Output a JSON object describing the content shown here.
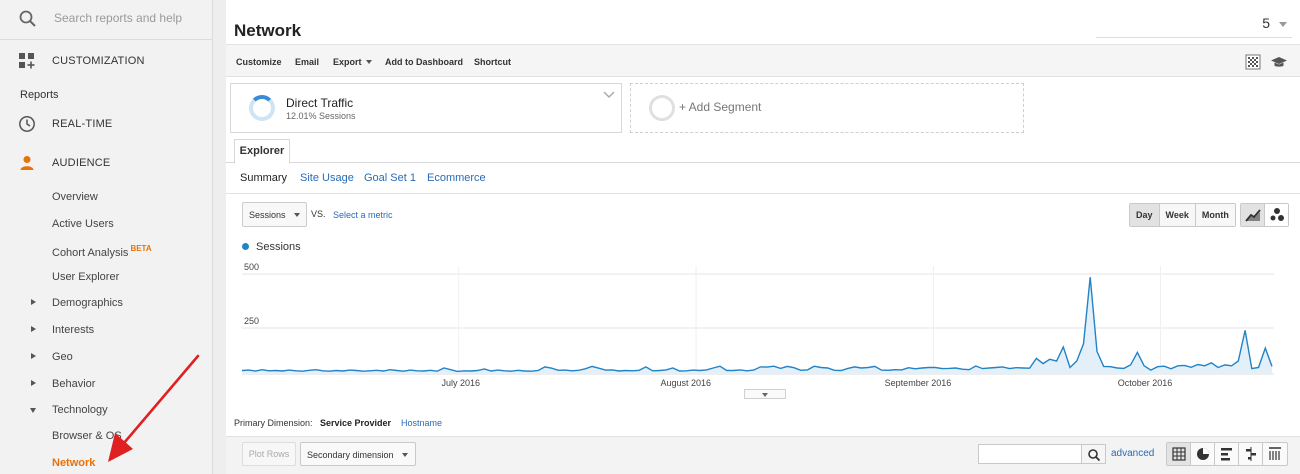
{
  "search": {
    "placeholder": "Search reports and help"
  },
  "nav": {
    "customization": "CUSTOMIZATION",
    "reports_heading": "Reports",
    "realtime": "REAL-TIME",
    "audience": "AUDIENCE",
    "audience_items": [
      {
        "label": "Overview"
      },
      {
        "label": "Active Users"
      },
      {
        "label": "Cohort Analysis",
        "badge": "BETA"
      },
      {
        "label": "User Explorer"
      },
      {
        "label": "Demographics"
      },
      {
        "label": "Interests"
      },
      {
        "label": "Geo"
      },
      {
        "label": "Behavior"
      },
      {
        "label": "Technology"
      },
      {
        "label": "Browser & OS"
      },
      {
        "label": "Network"
      }
    ]
  },
  "page": {
    "title": "Network",
    "date_fragment": "5"
  },
  "toolbar": {
    "customize": "Customize",
    "email": "Email",
    "export": "Export",
    "add_to_dashboard": "Add to Dashboard",
    "shortcut": "Shortcut"
  },
  "segments": {
    "active": {
      "name": "Direct Traffic",
      "sub": "12.01% Sessions"
    },
    "add": "+ Add Segment"
  },
  "tabs": {
    "explorer": "Explorer",
    "subtabs": [
      "Summary",
      "Site Usage",
      "Goal Set 1",
      "Ecommerce"
    ]
  },
  "metric": {
    "selected": "Sessions",
    "vs": "VS.",
    "select_metric": "Select a metric"
  },
  "periods": [
    "Day",
    "Week",
    "Month"
  ],
  "chart_data": {
    "type": "line",
    "series": [
      {
        "name": "Sessions",
        "values": [
          16,
          18,
          14,
          20,
          15,
          16,
          14,
          18,
          15,
          13,
          17,
          20,
          15,
          13,
          16,
          14,
          18,
          16,
          13,
          15,
          17,
          14,
          20,
          16,
          13,
          18,
          15,
          14,
          17,
          13,
          28,
          20,
          12,
          15,
          14,
          16,
          23,
          14,
          18,
          15,
          13,
          17,
          14,
          13,
          16,
          33,
          27,
          17,
          18,
          15,
          17,
          24,
          35,
          27,
          18,
          19,
          14,
          16,
          15,
          17,
          33,
          15,
          16,
          19,
          28,
          14,
          15,
          18,
          16,
          19,
          28,
          36,
          16,
          16,
          19,
          15,
          18,
          33,
          32,
          36,
          26,
          35,
          29,
          17,
          19,
          36,
          30,
          28,
          17,
          16,
          26,
          33,
          28,
          30,
          35,
          18,
          17,
          20,
          19,
          29,
          24,
          28,
          30,
          30,
          25,
          26,
          28,
          22,
          20,
          37,
          25,
          28,
          30,
          33,
          25,
          29,
          28,
          27,
          72,
          48,
          68,
          60,
          125,
          30,
          60,
          140,
          448,
          104,
          35,
          34,
          28,
          26,
          42,
          100,
          38,
          18,
          34,
          36,
          24,
          38,
          40,
          31,
          44,
          38,
          52,
          30,
          42,
          38,
          60,
          202,
          25,
          30,
          120,
          35
        ]
      }
    ],
    "x_tick_labels": [
      "July 2016",
      "August 2016",
      "September 2016",
      "October 2016"
    ],
    "y_tick_labels": [
      "500",
      "250"
    ],
    "ylim": [
      0,
      500
    ],
    "color": "#2283c6",
    "area_fill": "#e3f0fa",
    "grid": true
  },
  "primary_dimension": {
    "label": "Primary Dimension:",
    "selected": "Service Provider",
    "other": "Hostname"
  },
  "table_controls": {
    "plot_rows": "Plot Rows",
    "secondary_dimension": "Secondary dimension",
    "advanced": "advanced"
  }
}
